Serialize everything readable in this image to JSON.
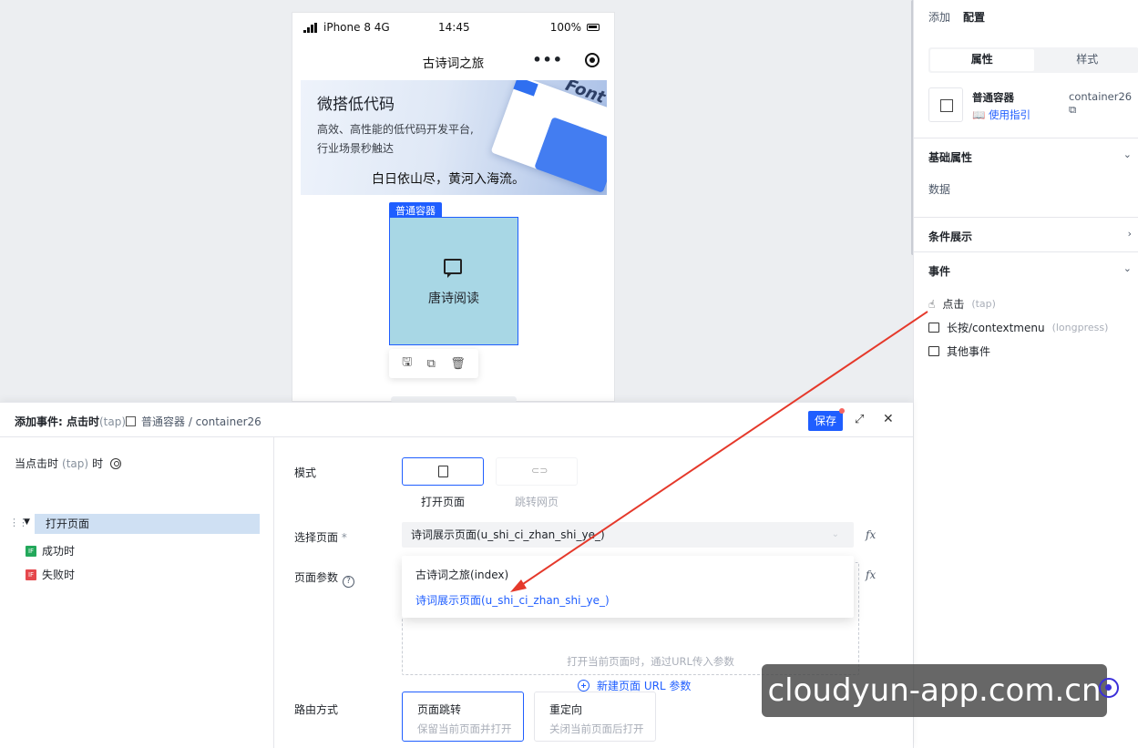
{
  "phone": {
    "carrier": "iPhone 8  4G",
    "time": "14:45",
    "battery": "100%",
    "page_title": "古诗词之旅",
    "more": "•••"
  },
  "banner": {
    "headline": "微搭低代码",
    "subline1": "高效、高性能的低代码开发平台,",
    "subline2": "行业场景秒触达",
    "poem": "白日依山尽，黄河入海流。",
    "deco_text": "Font"
  },
  "selected_component": {
    "tag": "普通容器",
    "label": "唐诗阅读"
  },
  "right_panel": {
    "tabs": [
      "添加",
      "配置"
    ],
    "segments": [
      "属性",
      "样式"
    ],
    "component_name": "普通容器",
    "component_id": "container26",
    "guide_link": "使用指引",
    "sections": {
      "basic": "基础属性",
      "basic_data": "数据",
      "conditional": "条件展示",
      "events": "事件"
    },
    "events": [
      {
        "label": "点击",
        "hint": "(tap)"
      },
      {
        "label": "长按/contextmenu",
        "hint": "(longpress)"
      },
      {
        "label": "其他事件",
        "hint": ""
      }
    ]
  },
  "dialog": {
    "title": "添加事件: 点击时",
    "title_hint": "(tap)",
    "crumb": "普通容器 / container26",
    "save": "保存",
    "trigger_prefix": "当点击时",
    "trigger_hint": "(tap)",
    "trigger_suffix": "时",
    "action": "打开页面",
    "success": "成功时",
    "failure": "失败时",
    "badge": "IF",
    "mode_label": "模式",
    "mode_open": "打开页面",
    "mode_url": "跳转网页",
    "page_label": "选择页面",
    "page_required": "*",
    "page_value": "诗词展示页面(u_shi_ci_zhan_shi_ye_)",
    "params_label": "页面参数",
    "params_hint": "打开当前页面时，通过URL传入参数",
    "new_param": "新建页面 URL 参数",
    "dropdown": [
      "古诗词之旅(index)",
      "诗词展示页面(u_shi_ci_zhan_shi_ye_)"
    ],
    "route_label": "路由方式",
    "route_options": [
      {
        "title": "页面跳转",
        "desc": "保留当前页面并打开"
      },
      {
        "title": "重定向",
        "desc": "关闭当前页面后打开"
      }
    ],
    "fx": "fx"
  },
  "watermark": "cloudyun-app.com.cn",
  "colors": {
    "accent": "#1f5eff",
    "annotation_arrow": "#e5392b",
    "container_fill": "#a8d7e5",
    "selected_row": "#cfe0f3"
  }
}
